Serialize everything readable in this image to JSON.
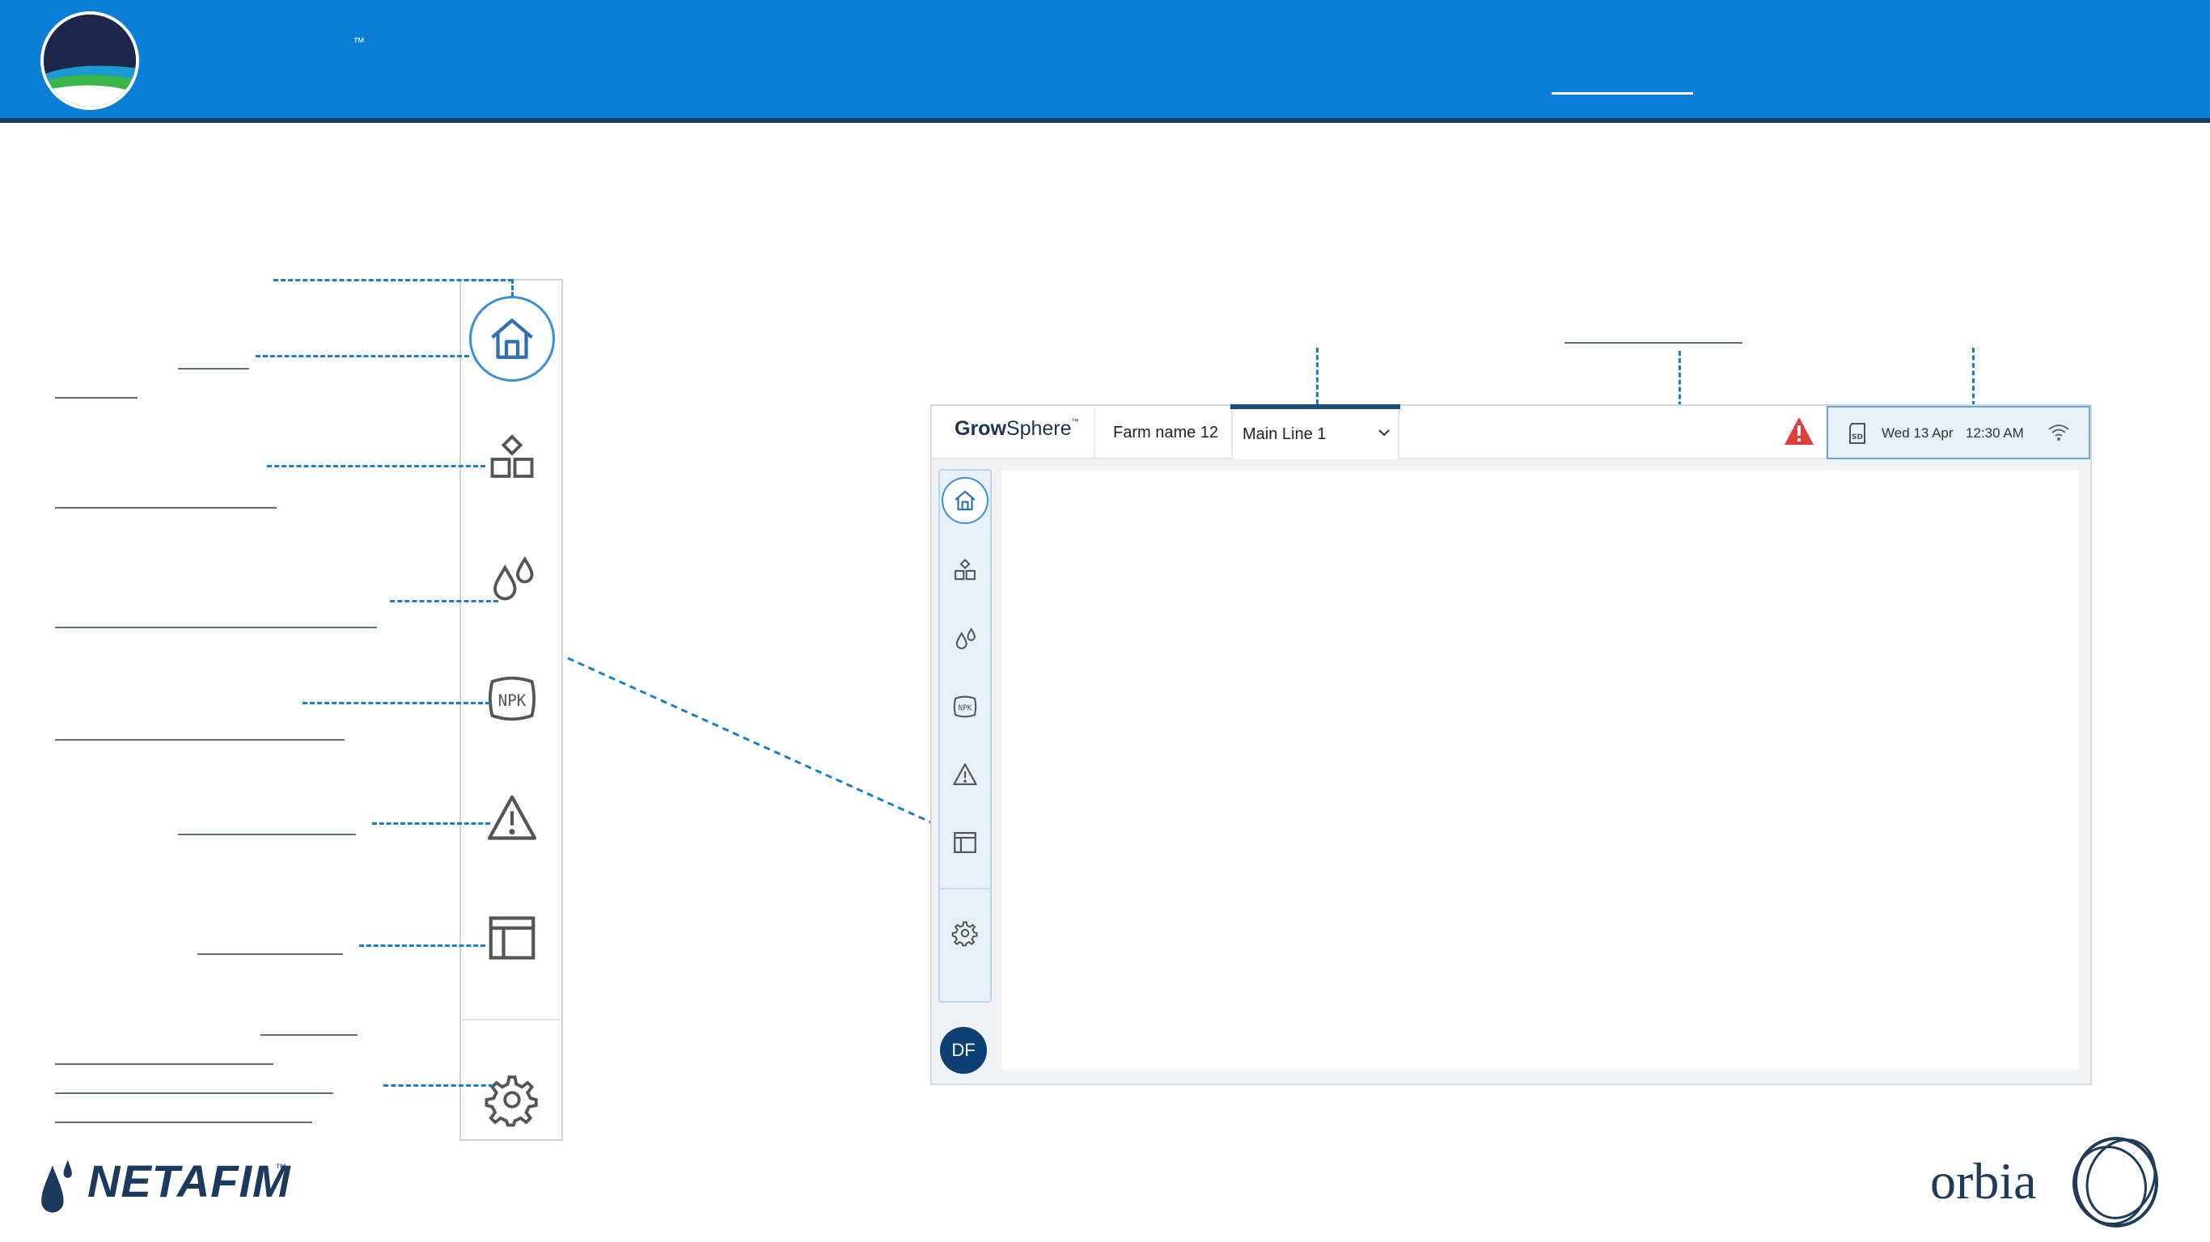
{
  "banner": {
    "tm": "™"
  },
  "app": {
    "logo_bold": "Grow",
    "logo_rest": "Sphere",
    "logo_tm": "™",
    "farm_name": "Farm name 12",
    "main_line": "Main Line 1",
    "status": {
      "date": "Wed 13 Apr",
      "time": "12:30 AM"
    },
    "avatar_initials": "DF"
  },
  "sidebar_icons": [
    "home-icon",
    "structure-icon",
    "water-drops-icon",
    "npk-icon",
    "alert-icon",
    "table-icon",
    "gear-icon"
  ],
  "footer": {
    "netafim": "NETAFIM",
    "netafim_tm": "™",
    "orbia": "orbia"
  },
  "colors": {
    "banner": "#0b7ed8",
    "accent": "#3a8fd6",
    "navy": "#1c3553",
    "alert": "#e23b3b",
    "annotation": "#1a7fc5"
  }
}
